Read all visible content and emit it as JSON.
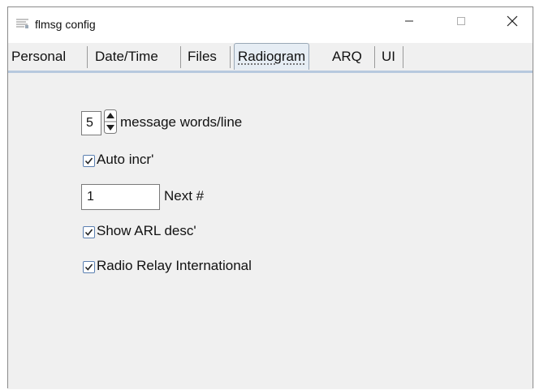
{
  "window": {
    "title": "flmsg config",
    "minimize_glyph": "—",
    "maximize_glyph": "☐",
    "close_glyph": "✕"
  },
  "tabs": [
    {
      "label": "Personal",
      "active": false
    },
    {
      "label": "Date/Time",
      "active": false
    },
    {
      "label": "Files",
      "active": false
    },
    {
      "label": "Radiogram",
      "active": true
    },
    {
      "label": "ARQ",
      "active": false
    },
    {
      "label": "UI",
      "active": false
    }
  ],
  "radiogram": {
    "words_per_line": {
      "value": "5",
      "label": "message words/line"
    },
    "auto_incr": {
      "label": "Auto incr'",
      "checked": true
    },
    "next_number": {
      "value": "1",
      "label": "Next #"
    },
    "show_arl_desc": {
      "label": "Show ARL desc'",
      "checked": true
    },
    "radio_relay_international": {
      "label": "Radio Relay International",
      "checked": true
    }
  },
  "colors": {
    "panel_bg": "#f0f0f0",
    "active_tab_bg": "#e6edf4",
    "tab_underline": "#b7c9de",
    "checkbox_border": "#5a7fb0"
  }
}
